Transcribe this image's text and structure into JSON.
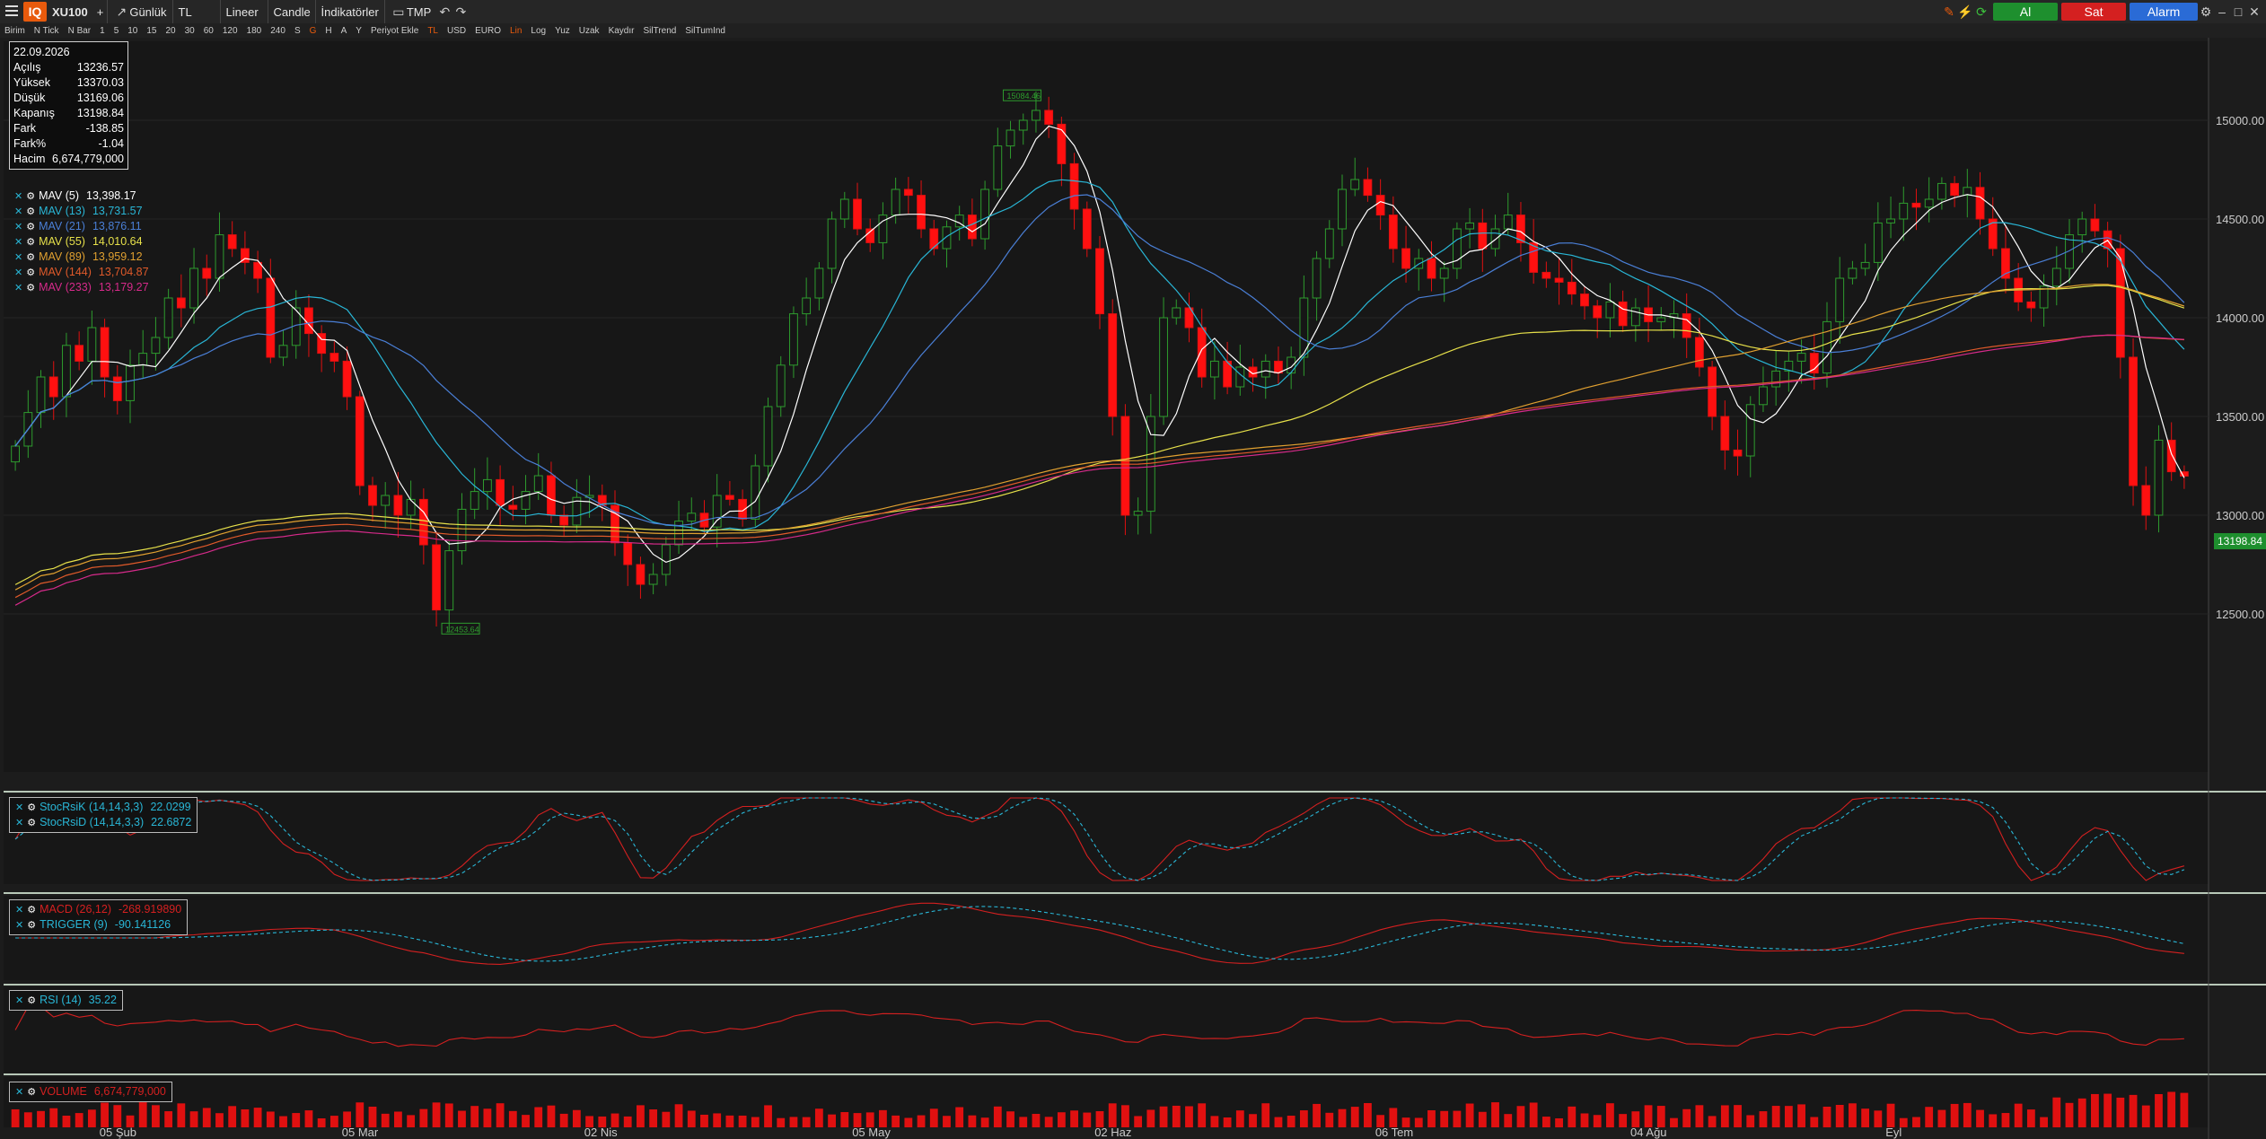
{
  "app": {
    "logo": "IQ",
    "symbol": "XU100",
    "plus": "+",
    "period": "Günlük",
    "currency": "TL",
    "scale": "Lineer",
    "style": "Candle",
    "indicators": "İndikatörler",
    "template": "TMP",
    "buy_label": "Al",
    "sell_label": "Sat",
    "alarm_label": "Alarm",
    "buy_color": "#1e8f2e",
    "sell_color": "#d42020",
    "alarm_color": "#2a6bd6"
  },
  "toolbar2": [
    "Birim",
    "N Tick",
    "N Bar",
    "1",
    "5",
    "10",
    "15",
    "20",
    "30",
    "60",
    "120",
    "180",
    "240",
    "S",
    "G",
    "H",
    "A",
    "Y",
    "Periyot Ekle",
    "TL",
    "USD",
    "EURO",
    "Lin",
    "Log",
    "Yuz",
    "Uzak",
    "Kaydır",
    "SilTrend",
    "SilTumInd"
  ],
  "ohlc": {
    "date": "22.09.2026",
    "rows": [
      {
        "label": "Açılış",
        "value": "13236.57"
      },
      {
        "label": "Yüksek",
        "value": "13370.03"
      },
      {
        "label": "Düşük",
        "value": "13169.06"
      },
      {
        "label": "Kapanış",
        "value": "13198.84"
      },
      {
        "label": "Fark",
        "value": "-138.85"
      },
      {
        "label": "Fark%",
        "value": "-1.04"
      },
      {
        "label": "Hacim",
        "value": "6,674,779,000"
      }
    ]
  },
  "mav_legend": [
    {
      "label": "MAV (5)",
      "value": "13,398.17",
      "color": "#ffffff"
    },
    {
      "label": "MAV (13)",
      "value": "13,731.57",
      "color": "#29b6d6"
    },
    {
      "label": "MAV (21)",
      "value": "13,876.11",
      "color": "#4a7fd6"
    },
    {
      "label": "MAV (55)",
      "value": "14,010.64",
      "color": "#e6e04a"
    },
    {
      "label": "MAV (89)",
      "value": "13,959.12",
      "color": "#e0a030"
    },
    {
      "label": "MAV (144)",
      "value": "13,704.87",
      "color": "#e05a2a"
    },
    {
      "label": "MAV (233)",
      "value": "13,179.27",
      "color": "#d62a8a"
    }
  ],
  "stoch_legend": [
    {
      "label": "StocRsiK (14,14,3,3)",
      "value": "22.0299",
      "color": "#29b6d6"
    },
    {
      "label": "StocRsiD (14,14,3,3)",
      "value": "22.6872",
      "color": "#29b6d6"
    }
  ],
  "macd_legend": [
    {
      "label": "MACD (26,12)",
      "value": "-268.919890",
      "color": "#d42020"
    },
    {
      "label": "TRIGGER (9)",
      "value": "-90.141126",
      "color": "#29b6d6"
    }
  ],
  "rsi_legend": [
    {
      "label": "RSI (14)",
      "value": "35.22",
      "color": "#29b6d6"
    }
  ],
  "vol_legend": [
    {
      "label": "VOLUME",
      "value": "6,674,779,000",
      "color": "#d42020"
    }
  ],
  "last_price_tag": "13198.84",
  "chart_data": {
    "type": "candlestick",
    "price_axis": {
      "ticks": [
        12500,
        13000,
        13500,
        14000,
        14500,
        15000
      ],
      "tick_labels": [
        "12500.00",
        "13000.00",
        "13500.00",
        "14000.00",
        "14500.00",
        "15000.00"
      ],
      "ylim": [
        11700,
        15400
      ]
    },
    "high_marker": "15084.46",
    "low_marker": "12453.64",
    "x_ticks": [
      "05 Şub",
      "05 Mar",
      "02 Nis",
      "05 May",
      "02 Haz",
      "06 Tem",
      "04 Ağu",
      "Eyl"
    ],
    "closes": [
      13350,
      13520,
      13700,
      13600,
      13860,
      13780,
      13950,
      13700,
      13580,
      13760,
      13820,
      13900,
      14100,
      14050,
      14250,
      14200,
      14420,
      14350,
      14280,
      14200,
      13800,
      13860,
      14050,
      13920,
      13820,
      13780,
      13600,
      13150,
      13050,
      13100,
      13000,
      13080,
      12850,
      12520,
      12820,
      13030,
      13120,
      13180,
      13050,
      13030,
      13120,
      13200,
      13000,
      12950,
      13090,
      13100,
      13050,
      12860,
      12750,
      12650,
      12700,
      12850,
      12970,
      13010,
      12940,
      13100,
      13080,
      12980,
      13250,
      13550,
      13760,
      14020,
      14100,
      14250,
      14500,
      14600,
      14450,
      14380,
      14520,
      14650,
      14620,
      14450,
      14350,
      14460,
      14520,
      14400,
      14650,
      14870,
      14950,
      15000,
      15050,
      14980,
      14780,
      14550,
      14350,
      14020,
      13500,
      13000,
      13020,
      13500,
      14000,
      14050,
      13950,
      13700,
      13780,
      13650,
      13750,
      13700,
      13780,
      13720,
      13800,
      14100,
      14300,
      14450,
      14650,
      14700,
      14620,
      14520,
      14350,
      14250,
      14300,
      14200,
      14250,
      14450,
      14480,
      14350,
      14450,
      14520,
      14380,
      14230,
      14200,
      14180,
      14120,
      14060,
      14000,
      14080,
      13960,
      14050,
      13980,
      14000,
      14020,
      13900,
      13750,
      13500,
      13330,
      13300,
      13560,
      13650,
      13730,
      13780,
      13820,
      13720,
      13980,
      14200,
      14250,
      14280,
      14480,
      14500,
      14580,
      14560,
      14600,
      14680,
      14620,
      14660,
      14500,
      14350,
      14200,
      14080,
      14050,
      14160,
      14250,
      14420,
      14500,
      14440,
      14350,
      13800,
      13150,
      13000,
      13380,
      13220,
      13198
    ]
  }
}
